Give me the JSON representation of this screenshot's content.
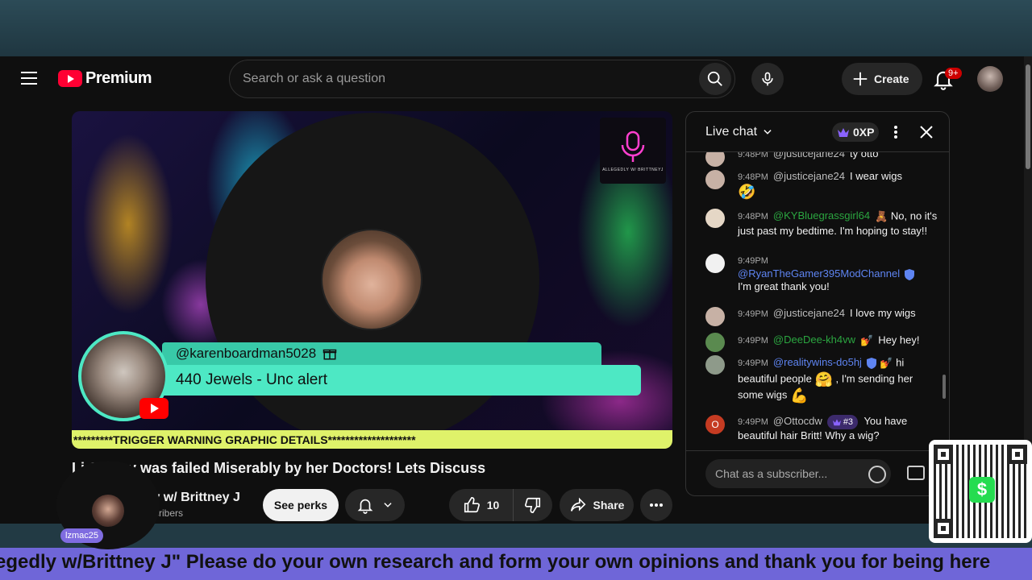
{
  "masthead": {
    "brand": "Premium",
    "search_placeholder": "Search or ask a question",
    "create_label": "Create",
    "notifications_badge": "9+"
  },
  "player": {
    "jewel_sender": "@karenboardman5028",
    "jewel_message": "440 Jewels - Unc alert",
    "warning_text": "*********TRIGGER WARNING GRAPHIC DETAILS********************",
    "logo_text": "ALLEGEDLY W/ BRITTNEYJ"
  },
  "video": {
    "title": "Li      Clancy was failed Miserably by her Doctors! Lets Discuss",
    "channel_name": "ly w/ Brittney J",
    "subscribers": "scribers",
    "perks_label": "See perks",
    "like_count": "10",
    "share_label": "Share"
  },
  "chat": {
    "title": "Live chat",
    "xp": "0XP",
    "input_placeholder": "Chat as a subscriber...",
    "messages": [
      {
        "time": "9:48PM",
        "author": "@justicejane24",
        "text": "ty otto"
      },
      {
        "time": "9:48PM",
        "author": "@justicejane24",
        "text": "I wear wigs"
      },
      {
        "time": "9:48PM",
        "author": "@KYBluegrassgirl64",
        "text": "No, no it's just past my bedtime. I'm hoping to stay!!"
      },
      {
        "time": "9:49PM",
        "author": "@RyanTheGamer395ModChannel",
        "text": "I'm great thank you!"
      },
      {
        "time": "9:49PM",
        "author": "@justicejane24",
        "text": "I love my wigs"
      },
      {
        "time": "9:49PM",
        "author": "@DeeDee-kh4vw",
        "text": "Hey hey!"
      },
      {
        "time": "9:49PM",
        "author": "@realitywins-do5hj",
        "text_a": "hi beautiful people",
        "text_b": ", I'm sending her some wigs"
      },
      {
        "time": "9:49PM",
        "author": "@Ottocdw",
        "rank": "#3",
        "text": "You have beautiful hair Britt! Why a wig?"
      }
    ]
  },
  "overlay": {
    "ticker": "egedly w/Brittney J\" Please do your own research and form your own opinions and thank you for being here",
    "viewer_tag": "lzmac25"
  },
  "colors": {
    "youtube_red": "#ff0033",
    "jewel_teal": "#4de8c4",
    "warning_yellow": "#dff26a",
    "ticker_purple": "#6f66d8"
  }
}
